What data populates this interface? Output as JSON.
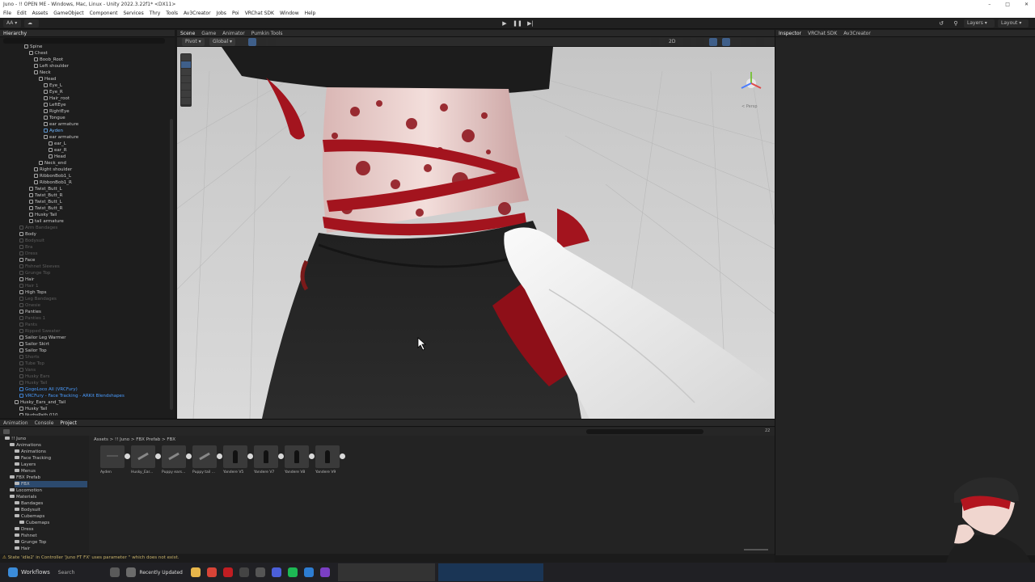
{
  "window": {
    "title": "Juno - !! OPEN ME - Windows, Mac, Linux - Unity 2022.3.22f1* <DX11>"
  },
  "menu": [
    "File",
    "Edit",
    "Assets",
    "GameObject",
    "Component",
    "Services",
    "Thry",
    "Tools",
    "Av3Creator",
    "Jobs",
    "Poi",
    "VRChat SDK",
    "Window",
    "Help"
  ],
  "toolbar": {
    "account": "AA",
    "layers": "Layers",
    "layout": "Layout"
  },
  "hierarchy": {
    "tab": "Hierarchy",
    "items": [
      {
        "label": "Spine",
        "indent": 5,
        "style": "normal"
      },
      {
        "label": "Chest",
        "indent": 6,
        "style": "normal"
      },
      {
        "label": "Boob_Root",
        "indent": 7,
        "style": "normal"
      },
      {
        "label": "Left shoulder",
        "indent": 7,
        "style": "normal"
      },
      {
        "label": "Neck",
        "indent": 7,
        "style": "normal"
      },
      {
        "label": "Head",
        "indent": 8,
        "style": "normal"
      },
      {
        "label": "Eye_L",
        "indent": 9,
        "style": "normal"
      },
      {
        "label": "Eye_R",
        "indent": 9,
        "style": "normal"
      },
      {
        "label": "Hair_root",
        "indent": 9,
        "style": "normal"
      },
      {
        "label": "LeftEye",
        "indent": 9,
        "style": "normal"
      },
      {
        "label": "RightEye",
        "indent": 9,
        "style": "normal"
      },
      {
        "label": "Tongue",
        "indent": 9,
        "style": "normal"
      },
      {
        "label": "ear armature",
        "indent": 9,
        "style": "normal"
      },
      {
        "label": "Ayden",
        "indent": 9,
        "style": "selected"
      },
      {
        "label": "ear armature",
        "indent": 9,
        "style": "normal"
      },
      {
        "label": "ear_L",
        "indent": 10,
        "style": "normal"
      },
      {
        "label": "ear_R",
        "indent": 10,
        "style": "normal"
      },
      {
        "label": "Head",
        "indent": 10,
        "style": "normal"
      },
      {
        "label": "Neck_end",
        "indent": 8,
        "style": "normal"
      },
      {
        "label": "Right shoulder",
        "indent": 7,
        "style": "normal"
      },
      {
        "label": "RibbonBob1_L",
        "indent": 7,
        "style": "normal"
      },
      {
        "label": "RibbonBob1_R",
        "indent": 7,
        "style": "normal"
      },
      {
        "label": "Twist_Butt_L",
        "indent": 6,
        "style": "normal"
      },
      {
        "label": "Twist_Butt_R",
        "indent": 6,
        "style": "normal"
      },
      {
        "label": "Twist_Butt_L",
        "indent": 6,
        "style": "normal"
      },
      {
        "label": "Twist_Butt_R",
        "indent": 6,
        "style": "normal"
      },
      {
        "label": "Husky Tail",
        "indent": 6,
        "style": "normal"
      },
      {
        "label": "tail armature",
        "indent": 6,
        "style": "normal"
      },
      {
        "label": "Arm Bandages",
        "indent": 4,
        "style": "dim"
      },
      {
        "label": "Body",
        "indent": 4,
        "style": "normal"
      },
      {
        "label": "Bodysuit",
        "indent": 4,
        "style": "dim"
      },
      {
        "label": "Bra",
        "indent": 4,
        "style": "dim"
      },
      {
        "label": "Dress",
        "indent": 4,
        "style": "dim"
      },
      {
        "label": "Face",
        "indent": 4,
        "style": "normal"
      },
      {
        "label": "Fishnet Sleeves",
        "indent": 4,
        "style": "dim"
      },
      {
        "label": "Grunge Top",
        "indent": 4,
        "style": "dim"
      },
      {
        "label": "Hair",
        "indent": 4,
        "style": "normal"
      },
      {
        "label": "Hair 1",
        "indent": 4,
        "style": "dim"
      },
      {
        "label": "High Tops",
        "indent": 4,
        "style": "normal"
      },
      {
        "label": "Leg Bandages",
        "indent": 4,
        "style": "dim"
      },
      {
        "label": "Onesie",
        "indent": 4,
        "style": "dim"
      },
      {
        "label": "Panties",
        "indent": 4,
        "style": "normal"
      },
      {
        "label": "Panties 1",
        "indent": 4,
        "style": "dim"
      },
      {
        "label": "Pants",
        "indent": 4,
        "style": "dim"
      },
      {
        "label": "Ripped Sweater",
        "indent": 4,
        "style": "dim"
      },
      {
        "label": "Sailor Leg Warmer",
        "indent": 4,
        "style": "normal"
      },
      {
        "label": "Sailor Skirt",
        "indent": 4,
        "style": "normal"
      },
      {
        "label": "Sailor Top",
        "indent": 4,
        "style": "normal"
      },
      {
        "label": "Shorts",
        "indent": 4,
        "style": "dim"
      },
      {
        "label": "Tube Top",
        "indent": 4,
        "style": "dim"
      },
      {
        "label": "Vans",
        "indent": 4,
        "style": "dim"
      },
      {
        "label": "Husky Ears",
        "indent": 4,
        "style": "dim"
      },
      {
        "label": "Husky Tail",
        "indent": 4,
        "style": "dim"
      },
      {
        "label": "GogoLoco All (VRCFury)",
        "indent": 4,
        "style": "blue"
      },
      {
        "label": "VRCFury - Face Tracking - ARKit Blendshapes",
        "indent": 4,
        "style": "blue"
      },
      {
        "label": "Husky_Ears_and_Tail",
        "indent": 3,
        "style": "normal"
      },
      {
        "label": "Husky Tail",
        "indent": 4,
        "style": "normal"
      },
      {
        "label": "NurbsPath.010",
        "indent": 4,
        "style": "normal"
      }
    ]
  },
  "scene": {
    "tabs": [
      "Scene",
      "Game",
      "Animator",
      "Pumkin Tools"
    ],
    "pivot": "Pivot",
    "global": "Global",
    "mode_2d": "2D",
    "persp": "< Persp"
  },
  "inspector": {
    "tabs": [
      "Inspector",
      "VRChat SDK",
      "Av3Creator"
    ]
  },
  "bottom": {
    "tabs": [
      "Animation",
      "Console",
      "Project"
    ],
    "breadcrumb": [
      "Assets",
      "!! Juno",
      "FBX Prefab",
      "FBX"
    ],
    "count": "22",
    "tree": [
      {
        "label": "!! Juno",
        "level": 1
      },
      {
        "label": "Animations",
        "level": 2
      },
      {
        "label": "Animations",
        "level": 3
      },
      {
        "label": "Face Tracking",
        "level": 3
      },
      {
        "label": "Layers",
        "level": 3
      },
      {
        "label": "Menus",
        "level": 3
      },
      {
        "label": "FBX Prefab",
        "level": 2
      },
      {
        "label": "FBX",
        "level": 3
      },
      {
        "label": "Locomotion",
        "level": 2
      },
      {
        "label": "Materials",
        "level": 2
      },
      {
        "label": "Bandages",
        "level": 3
      },
      {
        "label": "Bodysuit",
        "level": 3
      },
      {
        "label": "Cubemaps",
        "level": 3
      },
      {
        "label": "Cubemaps",
        "level": 4
      },
      {
        "label": "Dress",
        "level": 3
      },
      {
        "label": "Fishnet",
        "level": 3
      },
      {
        "label": "Grunge Top",
        "level": 3
      },
      {
        "label": "Hair",
        "level": 3
      }
    ],
    "assets": [
      {
        "label": "Ayden",
        "kind": "faint"
      },
      {
        "label": "Husky_Ear...",
        "kind": "sketch"
      },
      {
        "label": "Puppy ears...",
        "kind": "sketch"
      },
      {
        "label": "Puppy tail ...",
        "kind": "sketch"
      },
      {
        "label": "Yandere V5",
        "kind": "figure"
      },
      {
        "label": "Yandere V7",
        "kind": "figure"
      },
      {
        "label": "Yandere V8",
        "kind": "figure"
      },
      {
        "label": "Yandere V9",
        "kind": "figure"
      }
    ]
  },
  "status": {
    "message": "State 'idle2' in Controller 'Juno FT FX' uses parameter '' which does not exist."
  },
  "taskbar": {
    "workflows": "Workflows",
    "search": "Search",
    "recently": "Recently Updated"
  },
  "colors": {
    "accent_blue": "#4a9cff",
    "warning": "#e0b84a",
    "blood_red": "#a3141e"
  }
}
